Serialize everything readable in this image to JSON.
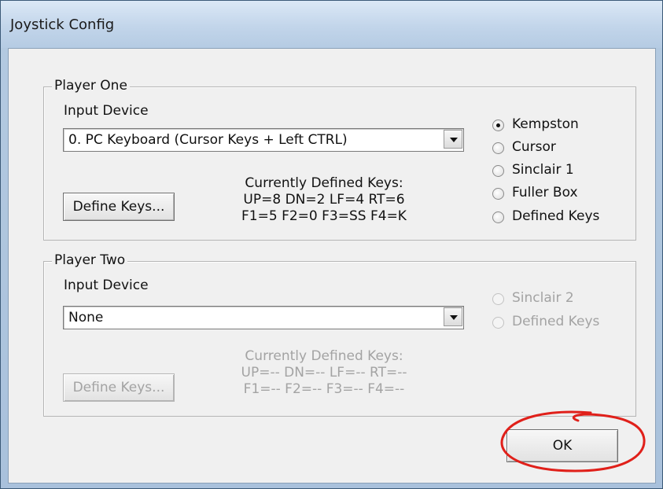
{
  "window": {
    "title": "Joystick Config"
  },
  "player_one": {
    "legend": "Player One",
    "input_device_label": "Input Device",
    "input_device_value": "0. PC Keyboard (Cursor Keys + Left CTRL)",
    "define_keys_label": "Define Keys...",
    "keys_heading": "Currently Defined Keys:",
    "keys_line1": "UP=8  DN=2  LF=4  RT=6",
    "keys_line2": "F1=5  F2=0  F3=SS  F4=K",
    "radios": [
      {
        "label": "Kempston",
        "checked": true
      },
      {
        "label": "Cursor",
        "checked": false
      },
      {
        "label": "Sinclair 1",
        "checked": false
      },
      {
        "label": "Fuller Box",
        "checked": false
      },
      {
        "label": "Defined Keys",
        "checked": false
      }
    ]
  },
  "player_two": {
    "legend": "Player Two",
    "input_device_label": "Input Device",
    "input_device_value": "None",
    "define_keys_label": "Define Keys...",
    "keys_heading": "Currently Defined Keys:",
    "keys_line1": "UP=--  DN=--  LF=--  RT=--",
    "keys_line2": "F1=--  F2=--  F3=--  F4=--",
    "radios": [
      {
        "label": "Sinclair 2",
        "checked": false
      },
      {
        "label": "Defined Keys",
        "checked": false
      }
    ]
  },
  "ok_label": "OK",
  "annotation_color": "#e0201a"
}
